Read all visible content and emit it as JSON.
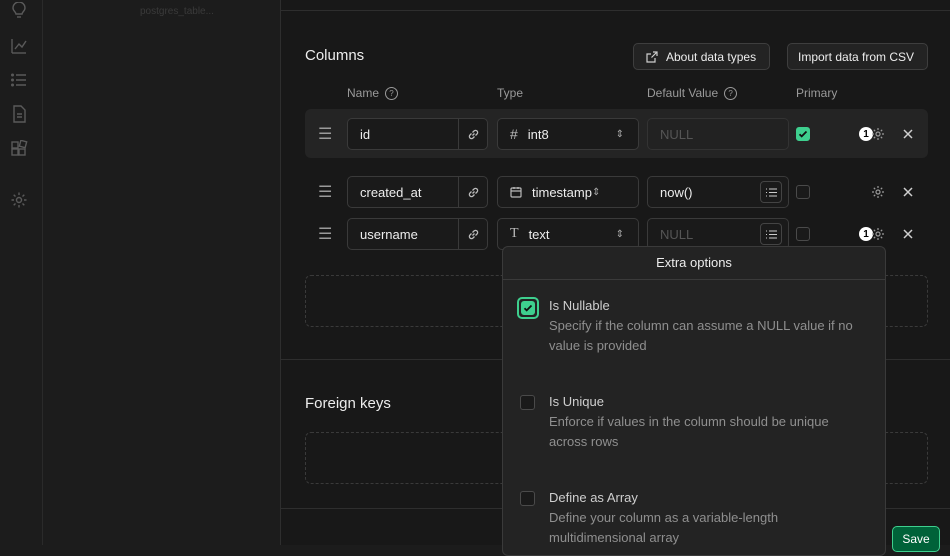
{
  "sidebar": {
    "faded_item": "postgres_table..."
  },
  "columns_section": {
    "title": "Columns",
    "about_button": "About data types",
    "import_button": "Import data from CSV",
    "headers": {
      "name": "Name",
      "type": "Type",
      "default": "Default Value",
      "primary": "Primary"
    },
    "rows": [
      {
        "name": "id",
        "type": "int8",
        "type_icon": "hash-icon",
        "default": "",
        "default_placeholder": "NULL",
        "primary": true,
        "badge": "1"
      },
      {
        "name": "created_at",
        "type": "timestamp",
        "type_icon": "calendar-icon",
        "default": "now()",
        "default_placeholder": "",
        "primary": false,
        "badge": ""
      },
      {
        "name": "username",
        "type": "text",
        "type_icon": "text-type-icon",
        "default": "",
        "default_placeholder": "NULL",
        "primary": false,
        "badge": "1"
      }
    ]
  },
  "foreign_keys_section": {
    "title": "Foreign keys"
  },
  "extra_options": {
    "title": "Extra options",
    "options": [
      {
        "label": "Is Nullable",
        "description": "Specify if the column can assume a NULL value if no value is provided",
        "checked": true
      },
      {
        "label": "Is Unique",
        "description": "Enforce if values in the column should be unique across rows",
        "checked": false
      },
      {
        "label": "Define as Array",
        "description": "Define your column as a variable-length multidimensional array",
        "checked": false
      }
    ]
  },
  "footer": {
    "save_label": "Save"
  },
  "colors": {
    "accent": "#3ecf8e",
    "save_bg": "#006239",
    "background": "#181818"
  }
}
